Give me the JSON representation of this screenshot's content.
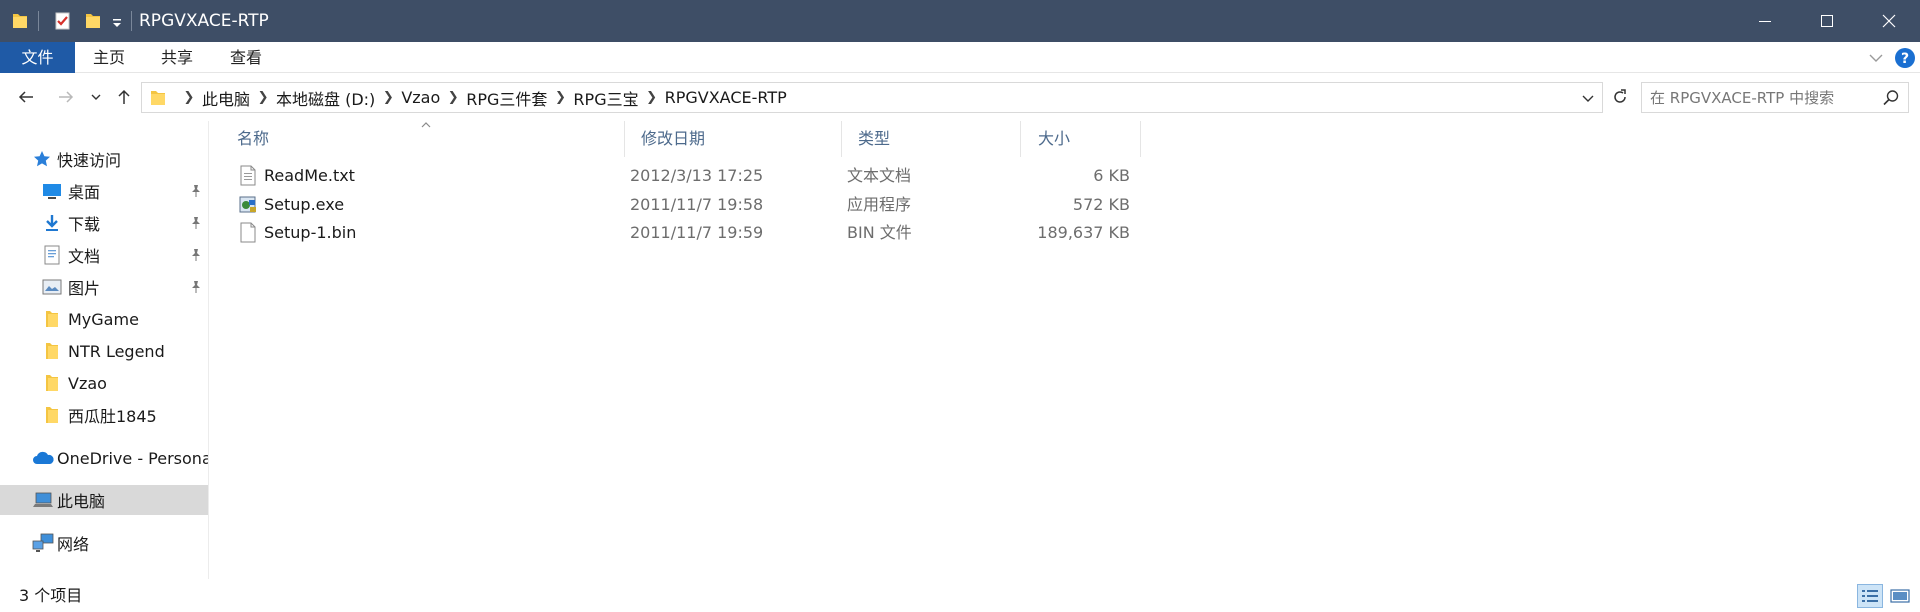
{
  "window": {
    "title": "RPGVXACE-RTP"
  },
  "ribbon": {
    "tabs": [
      {
        "label": "文件"
      },
      {
        "label": "主页"
      },
      {
        "label": "共享"
      },
      {
        "label": "查看"
      }
    ]
  },
  "address": {
    "crumbs": [
      "此电脑",
      "本地磁盘 (D:)",
      "Vzao",
      "RPG三件套",
      "RPG三宝",
      "RPGVXACE-RTP"
    ]
  },
  "search": {
    "placeholder": "在 RPGVXACE-RTP 中搜索"
  },
  "nav": {
    "quick_access": "快速访问",
    "items": [
      {
        "label": "桌面",
        "icon": "desktop-icon",
        "pinned": true
      },
      {
        "label": "下载",
        "icon": "download-icon",
        "pinned": true
      },
      {
        "label": "文档",
        "icon": "documents-icon",
        "pinned": true
      },
      {
        "label": "图片",
        "icon": "pictures-icon",
        "pinned": true
      },
      {
        "label": "MyGame",
        "icon": "folder-icon",
        "pinned": false
      },
      {
        "label": "NTR Legend",
        "icon": "folder-icon",
        "pinned": false
      },
      {
        "label": "Vzao",
        "icon": "folder-icon",
        "pinned": false
      },
      {
        "label": "西瓜肚1845",
        "icon": "folder-icon",
        "pinned": false
      }
    ],
    "onedrive": "OneDrive - Persona",
    "this_pc": "此电脑",
    "network": "网络"
  },
  "columns": {
    "name": "名称",
    "date": "修改日期",
    "type": "类型",
    "size": "大小"
  },
  "files": [
    {
      "name": "ReadMe.txt",
      "date": "2012/3/13 17:25",
      "type": "文本文档",
      "size": "6 KB",
      "icon": "text-file-icon"
    },
    {
      "name": "Setup.exe",
      "date": "2011/11/7 19:58",
      "type": "应用程序",
      "size": "572 KB",
      "icon": "setup-exe-icon"
    },
    {
      "name": "Setup-1.bin",
      "date": "2011/11/7 19:59",
      "type": "BIN 文件",
      "size": "189,637 KB",
      "icon": "blank-file-icon"
    }
  ],
  "status": {
    "item_count": "3 个项目"
  },
  "colors": {
    "titlebar": "#3e4e66",
    "file_tab": "#1f5aa6",
    "column_header_text": "#4d6a8c",
    "selected_nav": "#d9d9d9",
    "folder_yellow": "#f4c542",
    "help_blue": "#1a6fd1"
  }
}
